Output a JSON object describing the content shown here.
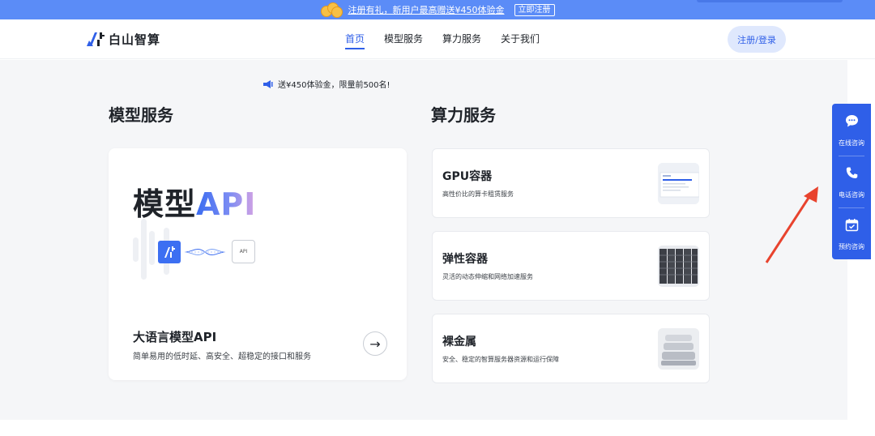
{
  "promo": {
    "text": "注册有礼，新用户最高赠送¥450体验金",
    "button": "立即注册"
  },
  "header": {
    "logo_text": "白山智算",
    "nav": [
      {
        "label": "首页",
        "active": true
      },
      {
        "label": "模型服务",
        "active": false
      },
      {
        "label": "算力服务",
        "active": false
      },
      {
        "label": "关于我们",
        "active": false
      }
    ],
    "login_label": "注册/登录"
  },
  "notice": {
    "icon": "megaphone-icon",
    "text": "送¥450体验金，限量前500名!"
  },
  "model_section": {
    "title": "模型服务",
    "card": {
      "headline_a": "模型",
      "headline_b": "API",
      "api_box": "API",
      "subtitle": "大语言模型API",
      "description": "简单易用的低时延、高安全、超稳定的接口和服务",
      "arrow": "→"
    }
  },
  "compute_section": {
    "title": "算力服务",
    "cards": [
      {
        "title": "GPU容器",
        "description": "高性价比的算卡租赁服务"
      },
      {
        "title": "弹性容器",
        "description": "灵活的动态伸缩和网络加速服务"
      },
      {
        "title": "裸金属",
        "description": "安全、稳定的智算服务器资源和运行保障"
      }
    ]
  },
  "float_panel": {
    "items": [
      {
        "label": "在线咨询",
        "icon": "chat-icon"
      },
      {
        "label": "电话咨询",
        "icon": "phone-icon"
      },
      {
        "label": "预约咨询",
        "icon": "calendar-icon"
      }
    ]
  },
  "colors": {
    "primary": "#2f5fe8",
    "banner": "#5b8cf7",
    "annotation_arrow": "#e8432e"
  }
}
